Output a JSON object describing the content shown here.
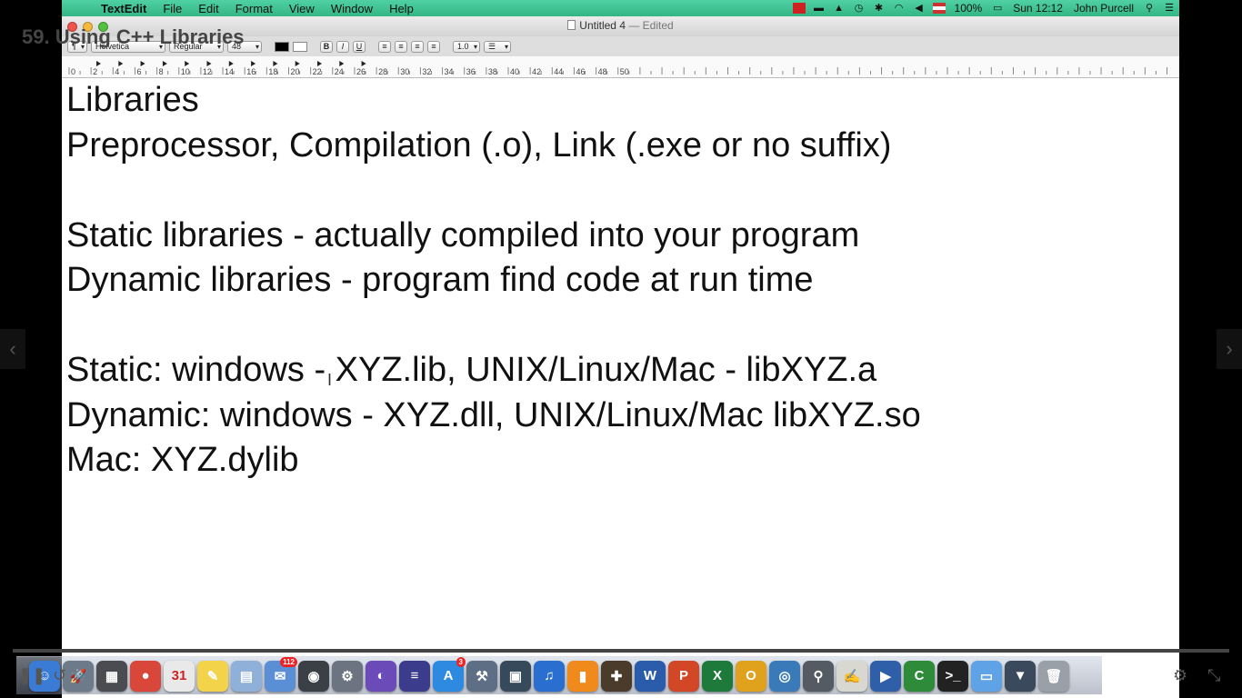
{
  "video": {
    "title": "59. Using C++ Libraries",
    "progress_fraction": 0.0,
    "prev_label": "‹",
    "next_label": "›"
  },
  "menubar": {
    "app_name": "TextEdit",
    "menus": [
      "File",
      "Edit",
      "Format",
      "View",
      "Window",
      "Help"
    ],
    "battery": "100%",
    "clock": "Sun 12:12",
    "user": "John Purcell"
  },
  "window": {
    "title": "Untitled 4",
    "status": "— Edited"
  },
  "toolbar": {
    "paragraph_style": "¶",
    "font_family": "Helvetica",
    "font_style": "Regular",
    "font_size": "48",
    "bold": "B",
    "italic": "I",
    "underline": "U",
    "line_spacing": "1.0"
  },
  "ruler": {
    "labels": [
      "0",
      "2",
      "4",
      "6",
      "8",
      "10",
      "12",
      "14",
      "16",
      "18",
      "20",
      "22",
      "24",
      "26",
      "28",
      "30",
      "32",
      "34",
      "36",
      "38",
      "40",
      "42",
      "44",
      "46",
      "48",
      "50"
    ]
  },
  "document": {
    "lines": [
      "Libraries",
      "Preprocessor, Compilation (.o), Link (.exe or no suffix)",
      "",
      "Static libraries - actually compiled into your program",
      "Dynamic libraries - program find code at run time",
      "",
      "Static: windows - XYZ.lib, UNIX/Linux/Mac - libXYZ.a",
      "Dynamic: windows - XYZ.dll, UNIX/Linux/Mac libXYZ.so",
      "Mac: XYZ.dylib"
    ]
  },
  "dock": {
    "items": [
      {
        "name": "finder-icon",
        "glyph": "☺",
        "color": "#3a7bd5"
      },
      {
        "name": "launchpad-icon",
        "glyph": "🚀",
        "color": "#6d7a8a"
      },
      {
        "name": "mission-control-icon",
        "glyph": "▦",
        "color": "#4b4b52"
      },
      {
        "name": "chrome-icon",
        "glyph": "●",
        "color": "#d9473b"
      },
      {
        "name": "calendar-icon",
        "glyph": "31",
        "color": "#e9e9e9"
      },
      {
        "name": "notes-icon",
        "glyph": "✎",
        "color": "#f2d34a"
      },
      {
        "name": "preview-icon",
        "glyph": "▤",
        "color": "#8fb0d8"
      },
      {
        "name": "mail-icon",
        "glyph": "✉",
        "color": "#5a8fd6",
        "badge": "112"
      },
      {
        "name": "facetime-icon",
        "glyph": "◉",
        "color": "#3b4046"
      },
      {
        "name": "system-prefs-icon",
        "glyph": "⚙",
        "color": "#6b7480"
      },
      {
        "name": "eclipse-icon",
        "glyph": "◐",
        "color": "#6b4bb8"
      },
      {
        "name": "eclipse-cpp-icon",
        "glyph": "≡",
        "color": "#3c3c8c"
      },
      {
        "name": "app-store-icon",
        "glyph": "A",
        "color": "#2d8ae0",
        "badge": "3"
      },
      {
        "name": "xcode-icon",
        "glyph": "⚒",
        "color": "#5d6e85"
      },
      {
        "name": "iphoto-icon",
        "glyph": "▣",
        "color": "#374a5c"
      },
      {
        "name": "itunes-icon",
        "glyph": "♫",
        "color": "#2a6fd0"
      },
      {
        "name": "ibooks-icon",
        "glyph": "▮",
        "color": "#f08a1c"
      },
      {
        "name": "instruments-icon",
        "glyph": "✚",
        "color": "#4a3b2a"
      },
      {
        "name": "word-icon",
        "glyph": "W",
        "color": "#2b5bab"
      },
      {
        "name": "powerpoint-icon",
        "glyph": "P",
        "color": "#d24726"
      },
      {
        "name": "excel-icon",
        "glyph": "X",
        "color": "#1d7a3a"
      },
      {
        "name": "outlook-icon",
        "glyph": "O",
        "color": "#e0a11c"
      },
      {
        "name": "network-icon",
        "glyph": "◎",
        "color": "#3a7ab8"
      },
      {
        "name": "utility-icon",
        "glyph": "⚲",
        "color": "#555b63"
      },
      {
        "name": "textedit-icon",
        "glyph": "✍",
        "color": "#d8d8d0"
      },
      {
        "name": "screenflow-icon",
        "glyph": "▶",
        "color": "#2f5fa8"
      },
      {
        "name": "camtasia-icon",
        "glyph": "C",
        "color": "#2e8b3a"
      },
      {
        "name": "terminal-icon",
        "glyph": ">_",
        "color": "#222222"
      },
      {
        "name": "folder-icon",
        "glyph": "▭",
        "color": "#5fa2e6"
      },
      {
        "name": "downloads-icon",
        "glyph": "▼",
        "color": "#3a4a5c"
      },
      {
        "name": "trash-icon",
        "glyph": "🗑",
        "color": "#9aa0a8"
      }
    ]
  },
  "colors": {
    "menubar": "#34b585",
    "progress": "#8a2aa0"
  }
}
